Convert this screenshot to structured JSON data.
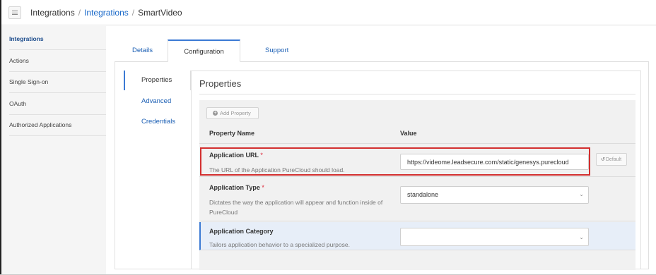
{
  "breadcrumb": {
    "root": "Integrations",
    "link": "Integrations",
    "current": "SmartVideo",
    "separator": "/"
  },
  "sidebar": {
    "items": [
      {
        "label": "Integrations",
        "active": true
      },
      {
        "label": "Actions"
      },
      {
        "label": "Single Sign-on"
      },
      {
        "label": "OAuth"
      },
      {
        "label": "Authorized Applications"
      }
    ]
  },
  "tabs": {
    "details": "Details",
    "configuration": "Configuration",
    "support": "Support",
    "active": "Configuration"
  },
  "subnav": {
    "properties": "Properties",
    "advanced": "Advanced",
    "credentials": "Credentials",
    "active": "Properties"
  },
  "properties": {
    "title": "Properties",
    "add_button": "Add Property",
    "col_name": "Property Name",
    "col_value": "Value",
    "default_button": "Default",
    "rows": [
      {
        "name": "Application URL",
        "required": "*",
        "description": "The URL of the Application PureCloud should load.",
        "value": "https://videome.leadsecure.com/static/genesys.purecloud"
      },
      {
        "name": "Application Type",
        "required": "*",
        "description": "Dictates the way the application will appear and function inside of PureCloud",
        "value": "standalone"
      },
      {
        "name": "Application Category",
        "description": "Tailors application behavior to a specialized purpose.",
        "value": ""
      }
    ]
  },
  "colors": {
    "accent": "#3b7ad4",
    "link": "#1b5fb4",
    "highlight_border": "#d32f2f",
    "highlight_row": "#e7eef8"
  },
  "icons": [
    "menu-icon",
    "plus-circle-icon",
    "undo-icon",
    "chevron-down-icon"
  ]
}
